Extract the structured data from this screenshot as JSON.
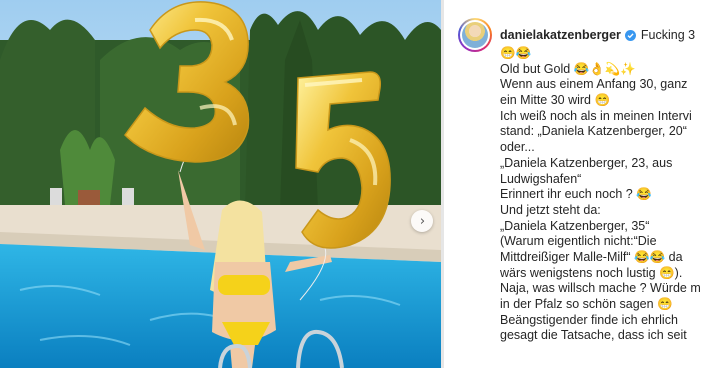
{
  "post": {
    "username": "danielakatzenberger",
    "caption_first_line": "Fucking 3",
    "caption_lines": [
      "😁😂",
      "Old but Gold 😂👌💫✨",
      "Wenn aus einem Anfang 30, ganz",
      "ein Mitte 30 wird 😁",
      "Ich weiß noch als in meinen Intervi",
      "stand: „Daniela Katzenberger, 20“",
      "oder...",
      "„Daniela Katzenberger, 23, aus",
      "Ludwigshafen“",
      "Erinnert ihr euch noch ? 😂",
      "Und jetzt steht da:",
      "„Daniela Katzenberger, 35“",
      "(Warum eigentlich nicht:“Die",
      "Mittdreißiger Malle-Milf“ 😂😂 da",
      "wärs wenigstens noch lustig 😁).",
      "Naja, was willsch mache ? Würde m",
      "in der Pfalz so schön sagen 😁",
      "Beängstigender finde ich ehrlich",
      "gesagt die Tatsache, dass ich seit"
    ]
  },
  "balloons": {
    "digit_left": "3",
    "digit_right": "5",
    "color": "#e8b430"
  },
  "icons": {
    "next": "chevron-right-icon",
    "verified": "verified-badge-icon"
  },
  "colors": {
    "pool": "#1aa6dc",
    "sky": "#a9d3f2",
    "verified": "#3897f0"
  }
}
